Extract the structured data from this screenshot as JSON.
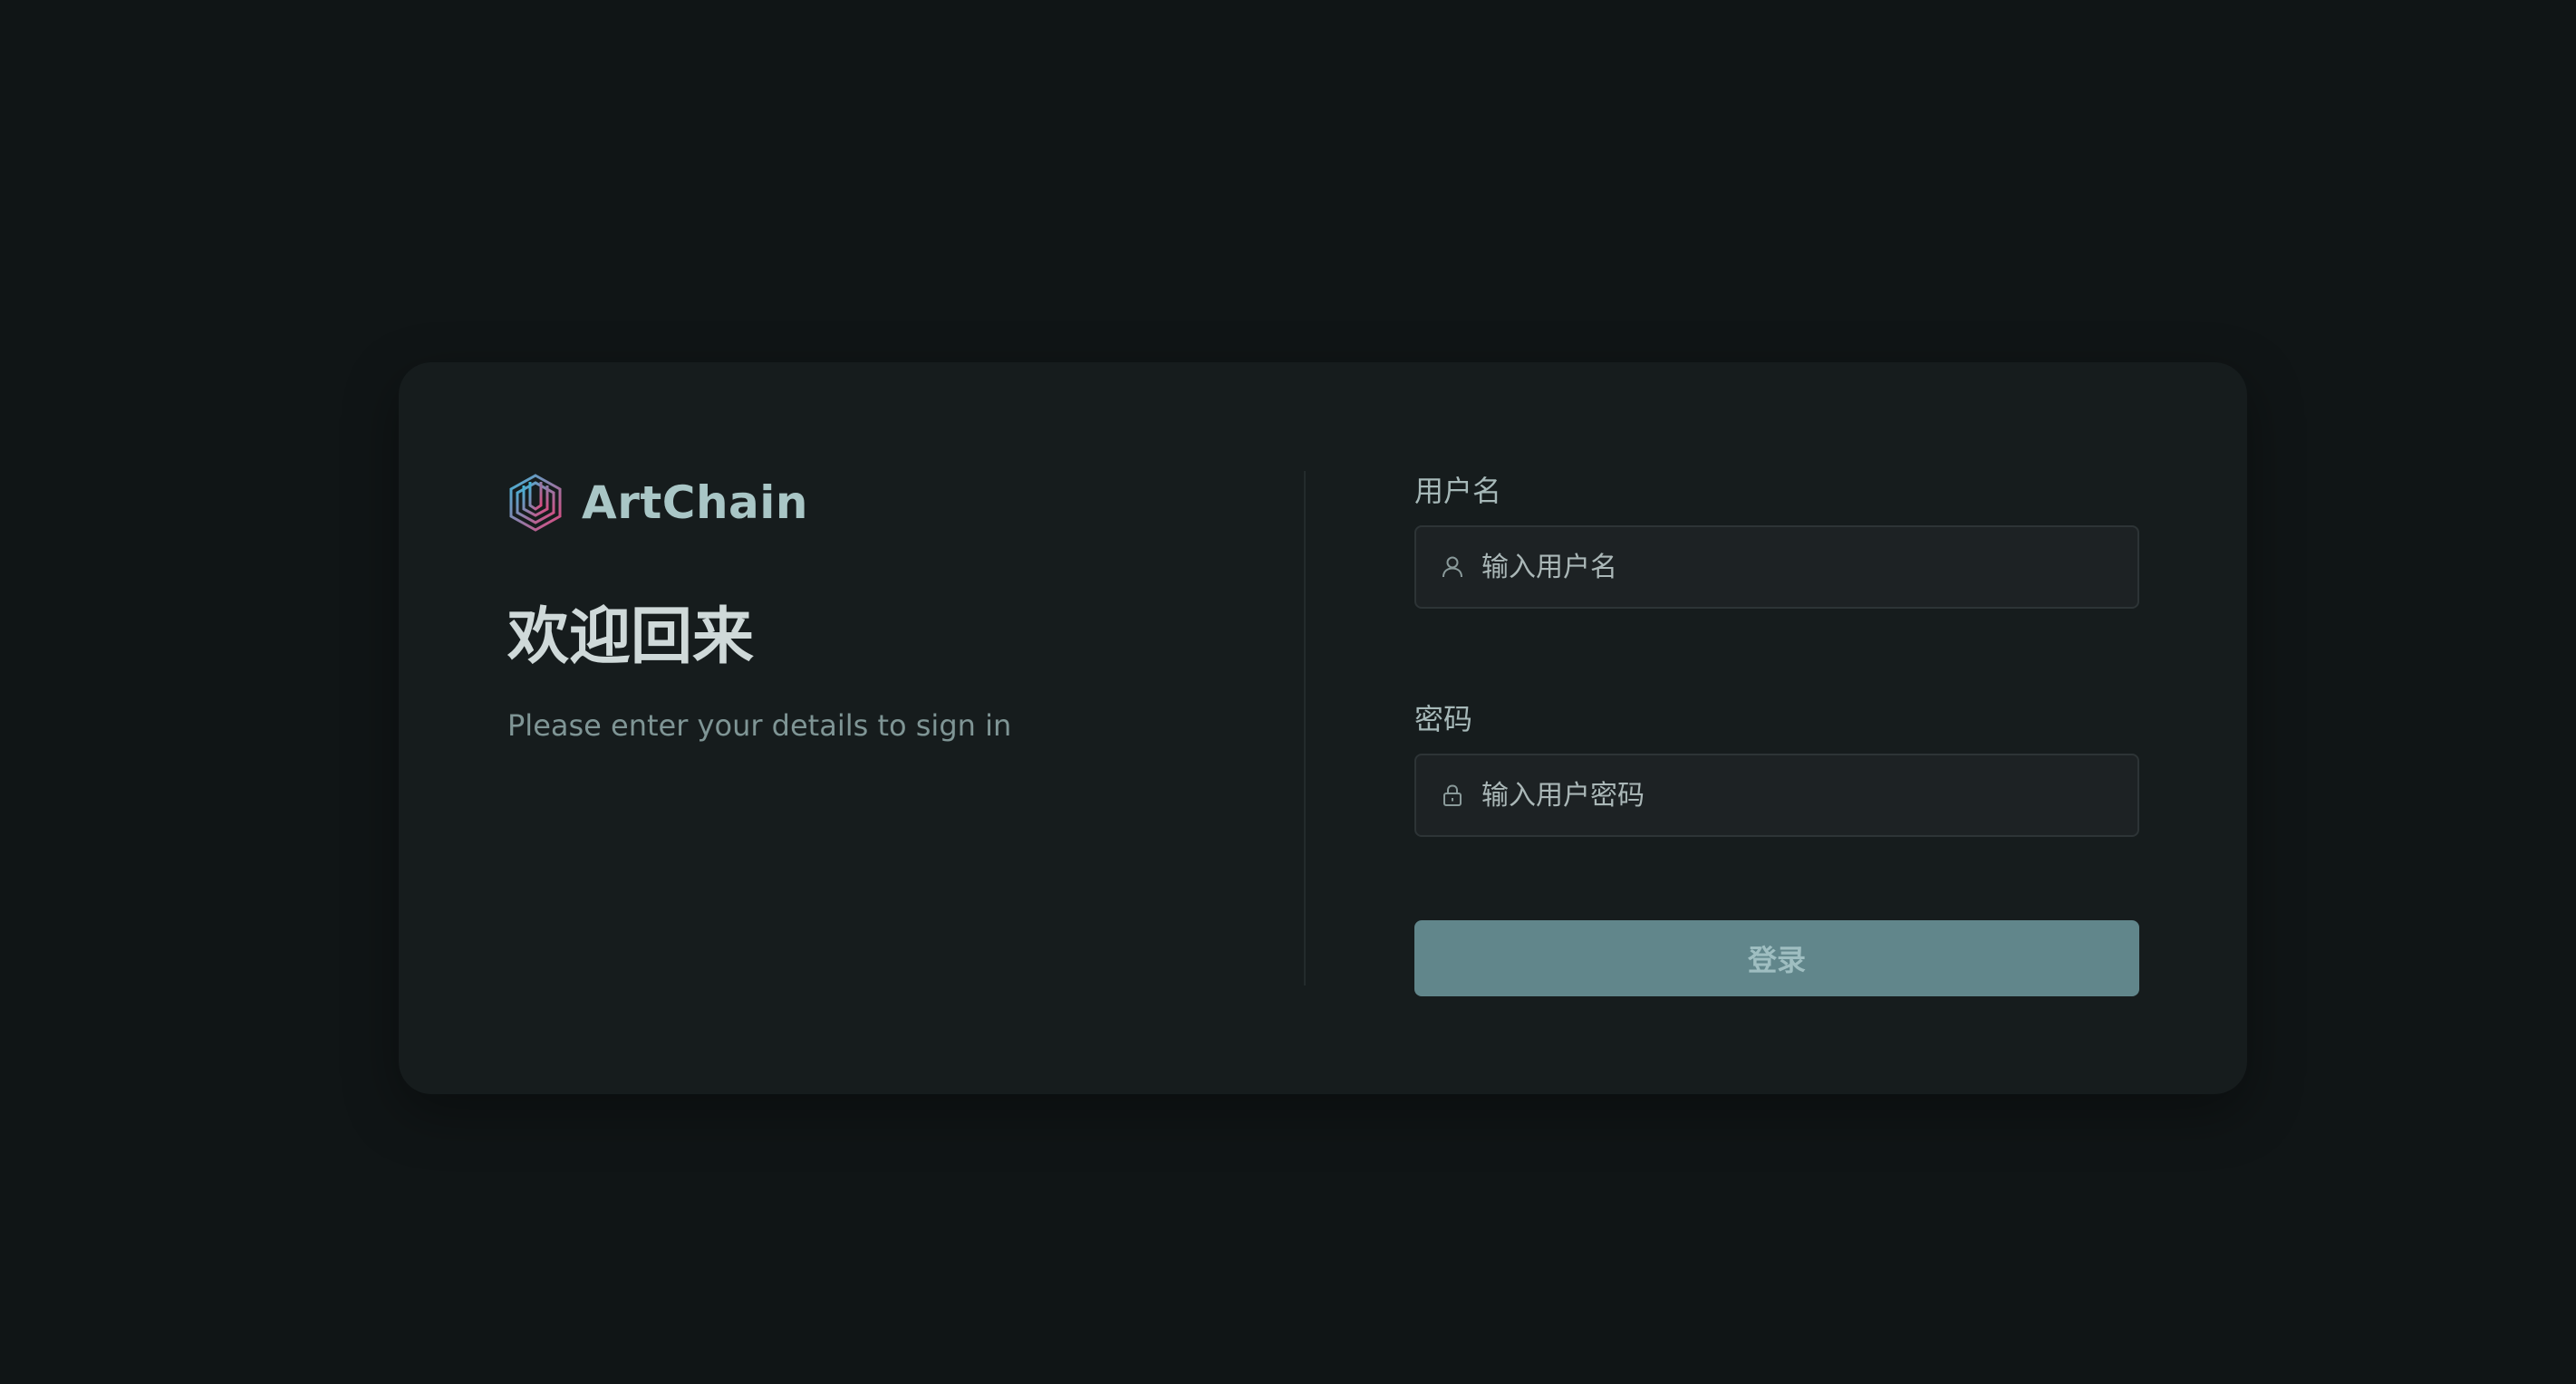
{
  "brand": {
    "name": "ArtChain",
    "logo_icon": "hexagon-logo-icon"
  },
  "intro": {
    "title": "欢迎回来",
    "subtitle": "Please enter your details to sign in"
  },
  "form": {
    "username": {
      "label": "用户名",
      "placeholder": "输入用户名",
      "icon": "user-icon",
      "value": ""
    },
    "password": {
      "label": "密码",
      "placeholder": "输入用户密码",
      "icon": "lock-icon",
      "value": ""
    },
    "submit_label": "登录"
  },
  "colors": {
    "background": "#101516",
    "card": "#161c1d",
    "brand_text": "#a9c6c6",
    "button": "#61868b",
    "logo_gradient_start": "#3fb6d8",
    "logo_gradient_end": "#e0457b"
  }
}
